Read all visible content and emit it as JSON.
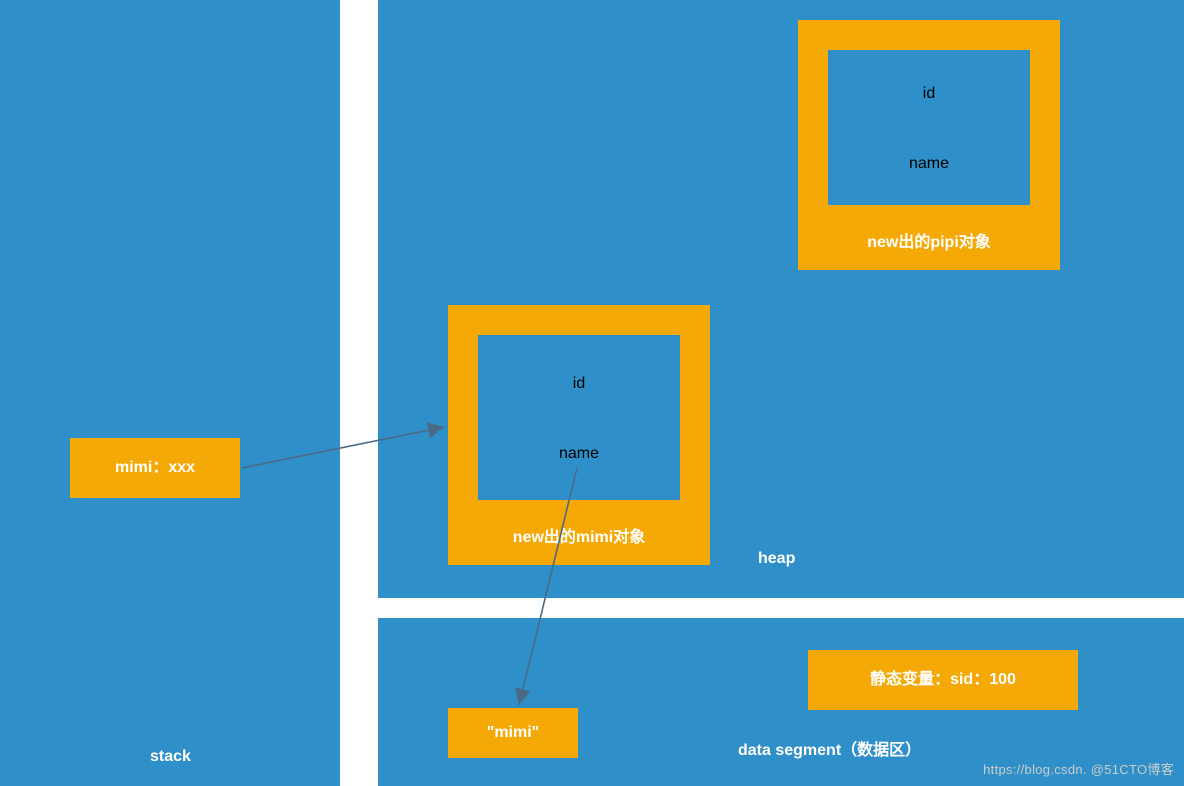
{
  "stack": {
    "label": "stack",
    "var_label": "mimi：xxx"
  },
  "heap": {
    "label": "heap",
    "mimi_obj": {
      "title": "new出的mimi对象",
      "field1": "id",
      "field2": "name"
    },
    "pipi_obj": {
      "title": "new出的pipi对象",
      "field1": "id",
      "field2": "name"
    }
  },
  "data_segment": {
    "label": "data segment（数据区）",
    "literal": "\"mimi\"",
    "static_var": "静态变量：sid：100"
  },
  "watermark": "https://blog.csdn. @51CTO博客"
}
